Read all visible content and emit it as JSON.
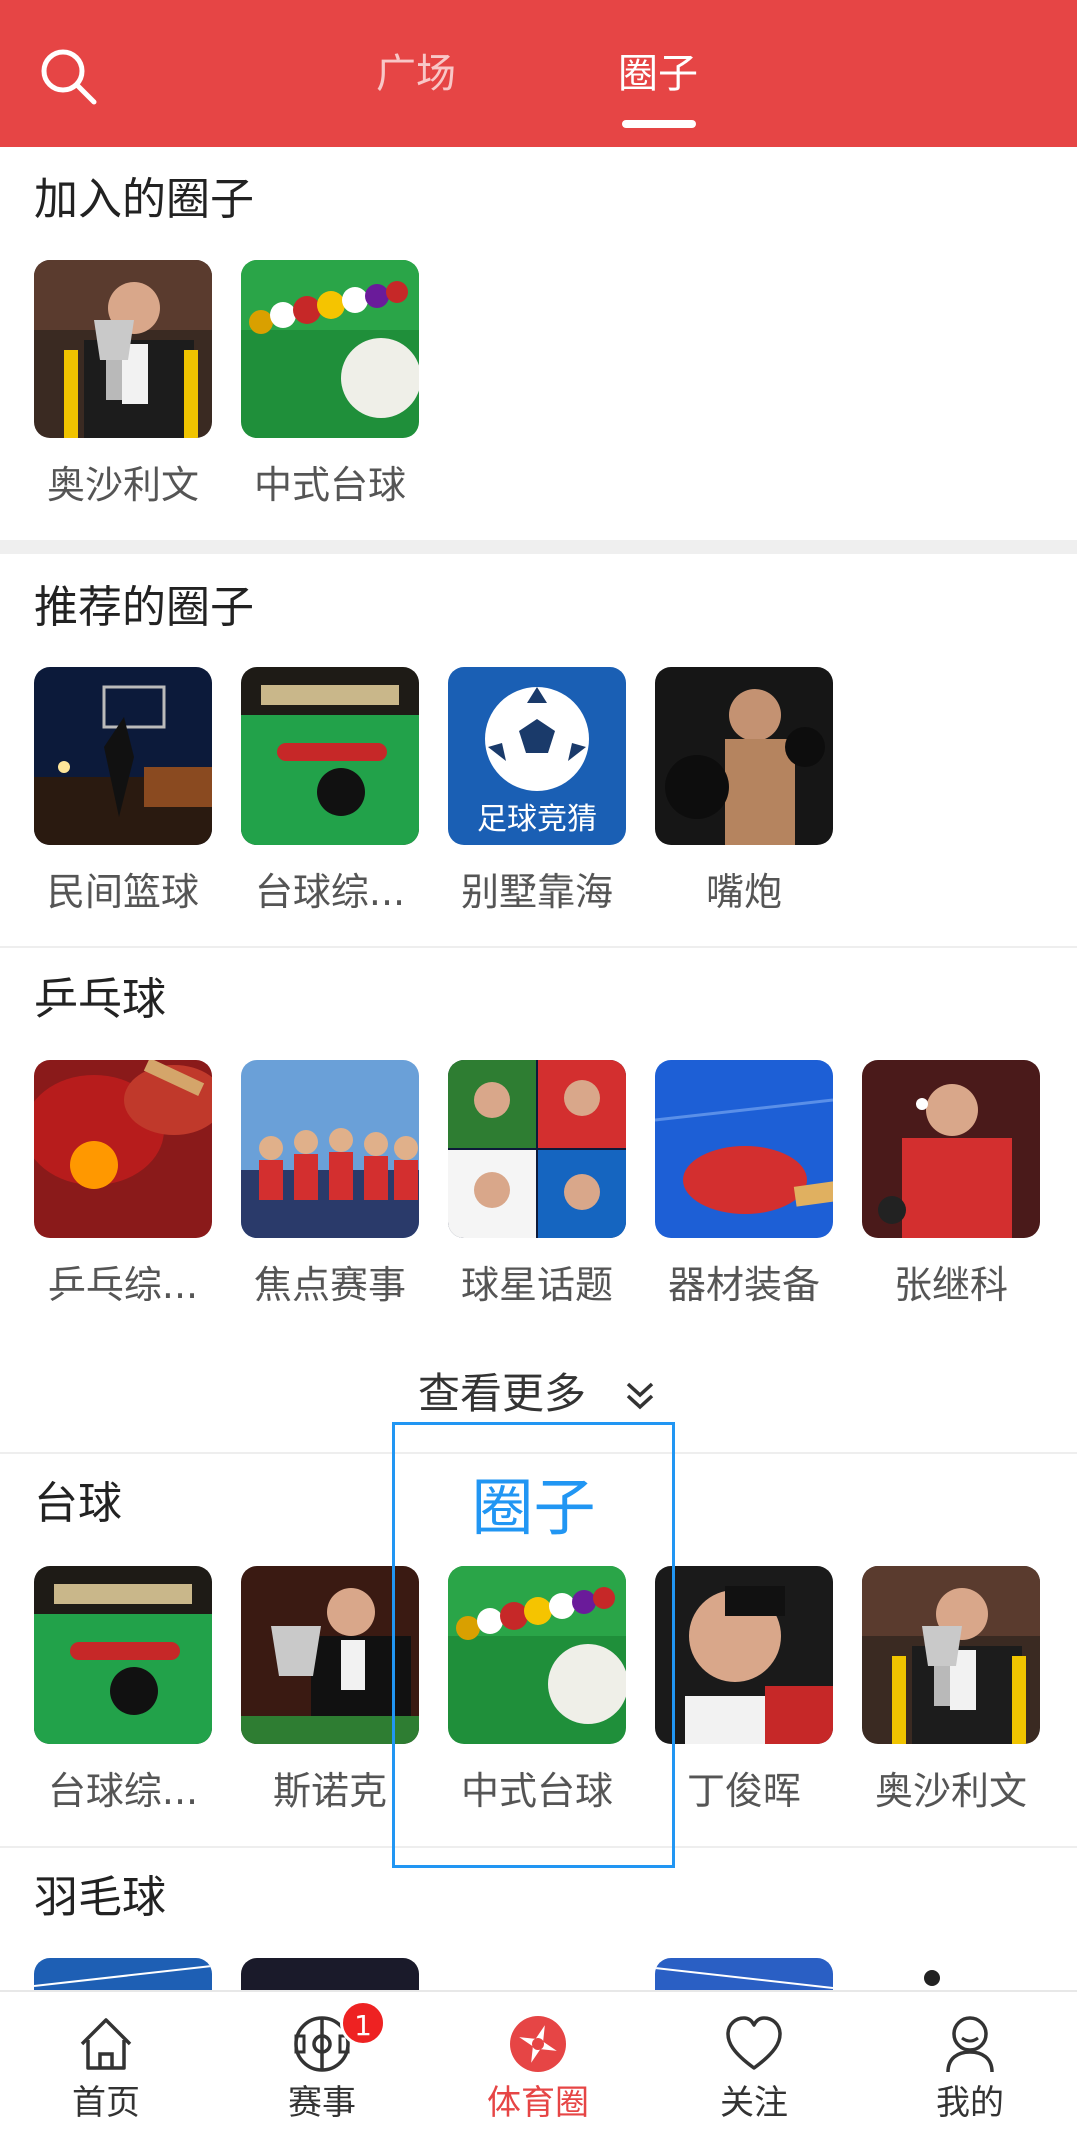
{
  "header": {
    "tabs": [
      {
        "label": "广场",
        "active": false
      },
      {
        "label": "圈子",
        "active": true
      }
    ],
    "search_icon": "search-icon",
    "background_color": "#e64545"
  },
  "joined": {
    "title": "加入的圈子",
    "items": [
      {
        "label": "奥沙利文",
        "image": "trophy-player-photo"
      },
      {
        "label": "中式台球",
        "image": "billiard-balls-photo"
      }
    ]
  },
  "recommended": {
    "title": "推荐的圈子",
    "items": [
      {
        "label": "民间篮球",
        "image": "basketball-night-photo"
      },
      {
        "label": "台球综...",
        "image": "snooker-table-photo"
      },
      {
        "label": "别墅靠海",
        "image": "football-quiz-logo",
        "logo_text": "足球竞猜"
      },
      {
        "label": "嘴炮",
        "image": "fighter-photo"
      }
    ]
  },
  "pingpong": {
    "title": "乒乓球",
    "items": [
      {
        "label": "乒乓综...",
        "image": "paddles-ball-photo"
      },
      {
        "label": "焦点赛事",
        "image": "team-photo"
      },
      {
        "label": "球星话题",
        "image": "players-collage-photo"
      },
      {
        "label": "器材装备",
        "image": "paddle-on-table-photo"
      },
      {
        "label": "张继科",
        "image": "player-photo"
      }
    ],
    "more_label": "查看更多",
    "more_icon": "double-chevron-down-icon"
  },
  "billiards": {
    "title": "台球",
    "items": [
      {
        "label": "台球综...",
        "image": "snooker-table-photo"
      },
      {
        "label": "斯诺克",
        "image": "snooker-player-trophy-photo"
      },
      {
        "label": "中式台球",
        "image": "billiard-balls-photo"
      },
      {
        "label": "丁俊晖",
        "image": "player-portrait-photo"
      },
      {
        "label": "奥沙利文",
        "image": "trophy-player-photo"
      }
    ]
  },
  "badminton": {
    "title": "羽毛球"
  },
  "overlay": {
    "label": "圈子",
    "color": "#2196f3"
  },
  "bottom_nav": {
    "items": [
      {
        "label": "首页",
        "icon": "home-icon",
        "active": false
      },
      {
        "label": "赛事",
        "icon": "match-icon",
        "active": false,
        "badge": "1"
      },
      {
        "label": "体育圈",
        "icon": "sports-circle-icon",
        "active": true
      },
      {
        "label": "关注",
        "icon": "heart-icon",
        "active": false
      },
      {
        "label": "我的",
        "icon": "profile-icon",
        "active": false
      }
    ]
  }
}
